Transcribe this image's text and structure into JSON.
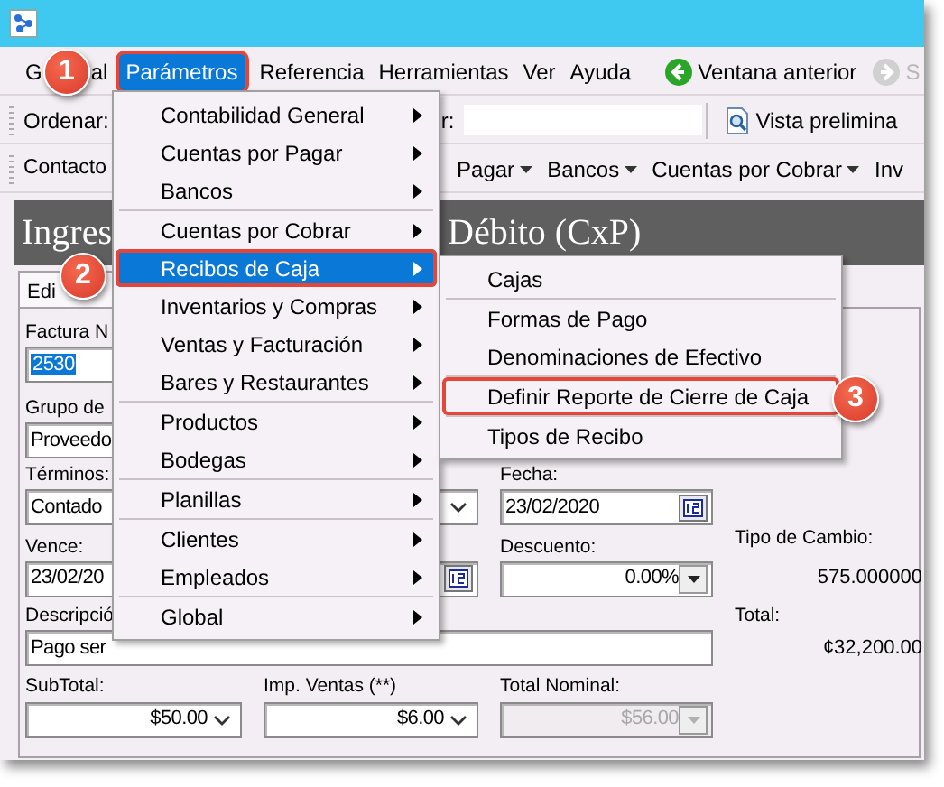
{
  "menu_bar": {
    "items": [
      {
        "label": "G",
        "label_after": "al",
        "selected": false,
        "outlined": false
      },
      {
        "label": "Parámetros",
        "selected": true,
        "outlined": true
      },
      {
        "label": "Referencia",
        "selected": false,
        "outlined": false
      },
      {
        "label": "Herramientas",
        "selected": false,
        "outlined": false
      },
      {
        "label": "Ver",
        "selected": false,
        "outlined": false
      },
      {
        "label": "Ayuda",
        "selected": false,
        "outlined": false
      }
    ],
    "nav": [
      {
        "label": "Ventana anterior",
        "disabled": false
      },
      {
        "label": "S",
        "disabled": true
      }
    ]
  },
  "sort_bar": {
    "sort_label": "Ordenar:",
    "filter_label": "r:",
    "preview_label": "Vista prelimina"
  },
  "module_bar": {
    "items": [
      {
        "label": "Contacto",
        "dropdown": false
      },
      {
        "label": "Pagar",
        "dropdown": true
      },
      {
        "label": "Bancos",
        "dropdown": true
      },
      {
        "label": "Cuentas por Cobrar",
        "dropdown": true
      },
      {
        "label": "Inv",
        "dropdown": false
      }
    ]
  },
  "header": {
    "title_start": "Ingres",
    "title_end": "Débito (CxP)"
  },
  "tabs": [
    {
      "label": "Edi",
      "selected": true
    }
  ],
  "form": {
    "invoice": {
      "label": "Factura N",
      "value": "2530",
      "text_selected": true
    },
    "group": {
      "label": "Grupo de",
      "value": "Proveedo"
    },
    "terms": {
      "label": "Términos:",
      "value": "Contado",
      "kind": "combo"
    },
    "date": {
      "label": "Fecha:",
      "value": "23/02/2020",
      "kind": "date"
    },
    "due": {
      "label": "Vence:",
      "value": "23/02/20",
      "kind": "date"
    },
    "discount": {
      "label": "Descuento:",
      "value": "0.00%",
      "kind": "spin"
    },
    "exchange": {
      "label": "Tipo de Cambio:",
      "value": "575.000000"
    },
    "total": {
      "label": "Total:",
      "value": "¢32,200.00"
    },
    "description": {
      "label": "Descripció",
      "value": "Pago ser"
    },
    "subtotal": {
      "label": "SubTotal:",
      "value": "$50.00",
      "kind": "combo"
    },
    "tax": {
      "label": "Imp. Ventas (**)",
      "value": "$6.00",
      "kind": "combo"
    },
    "nominal": {
      "label": "Total Nominal:",
      "value": "$56.00",
      "kind": "spin",
      "disabled": true
    }
  },
  "menu": {
    "items": [
      {
        "kind": "item",
        "label": "Contabilidad General",
        "submenu": true,
        "selected": false,
        "outlined": false
      },
      {
        "kind": "item",
        "label": "Cuentas por Pagar",
        "submenu": true,
        "selected": false,
        "outlined": false
      },
      {
        "kind": "item",
        "label": "Bancos",
        "submenu": true,
        "selected": false,
        "outlined": false
      },
      {
        "kind": "separator"
      },
      {
        "kind": "item",
        "label": "Cuentas por Cobrar",
        "submenu": true,
        "selected": false,
        "outlined": false
      },
      {
        "kind": "item",
        "label": "Recibos de Caja",
        "submenu": true,
        "selected": true,
        "outlined": true
      },
      {
        "kind": "item",
        "label": "Inventarios y Compras",
        "submenu": true,
        "selected": false,
        "outlined": false
      },
      {
        "kind": "item",
        "label": "Ventas y Facturación",
        "submenu": true,
        "selected": false,
        "outlined": false
      },
      {
        "kind": "item",
        "label": "Bares y Restaurantes",
        "submenu": true,
        "selected": false,
        "outlined": false
      },
      {
        "kind": "separator"
      },
      {
        "kind": "item",
        "label": "Productos",
        "submenu": true,
        "selected": false,
        "outlined": false
      },
      {
        "kind": "item",
        "label": "Bodegas",
        "submenu": true,
        "selected": false,
        "outlined": false
      },
      {
        "kind": "separator"
      },
      {
        "kind": "item",
        "label": "Planillas",
        "submenu": true,
        "selected": false,
        "outlined": false
      },
      {
        "kind": "separator"
      },
      {
        "kind": "item",
        "label": "Clientes",
        "submenu": true,
        "selected": false,
        "outlined": false
      },
      {
        "kind": "item",
        "label": "Empleados",
        "submenu": true,
        "selected": false,
        "outlined": false
      },
      {
        "kind": "separator"
      },
      {
        "kind": "item",
        "label": "Global",
        "submenu": true,
        "selected": false,
        "outlined": false
      }
    ]
  },
  "submenu": {
    "items": [
      {
        "kind": "item",
        "label": "Cajas",
        "submenu": false,
        "selected": false,
        "outlined": false
      },
      {
        "kind": "separator"
      },
      {
        "kind": "item",
        "label": "Formas de Pago",
        "submenu": false,
        "selected": false,
        "outlined": false
      },
      {
        "kind": "item",
        "label": "Denominaciones de Efectivo",
        "submenu": false,
        "selected": false,
        "outlined": false
      },
      {
        "kind": "separator"
      },
      {
        "kind": "item",
        "label": "Definir Reporte de Cierre de Caja",
        "submenu": false,
        "selected": false,
        "outlined": true
      },
      {
        "kind": "separator"
      },
      {
        "kind": "item",
        "label": "Tipos de Recibo",
        "submenu": false,
        "selected": false,
        "outlined": false
      }
    ]
  },
  "callouts": [
    {
      "number": "1"
    },
    {
      "number": "2"
    },
    {
      "number": "3"
    }
  ]
}
